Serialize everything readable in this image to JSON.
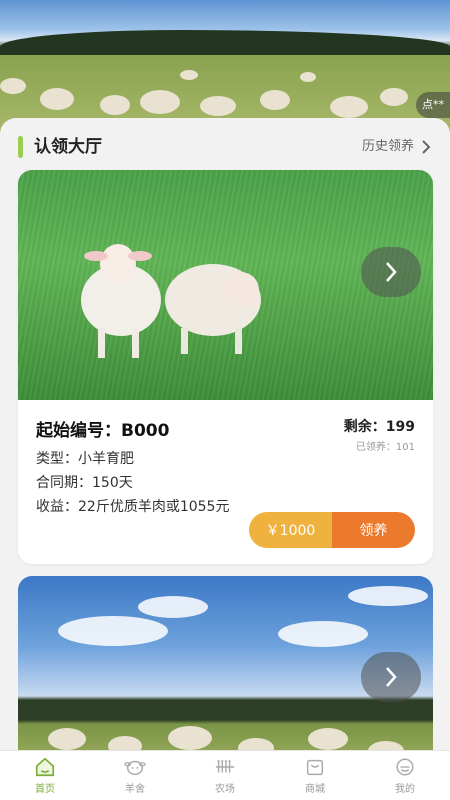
{
  "banner": {
    "badge_text": "点**"
  },
  "section": {
    "title": "认领大厅",
    "history_label": "历史领养"
  },
  "card": {
    "code": "起始编号：B000",
    "remain": "剩余：199",
    "adopted": "已领养：101",
    "type": "类型：小羊育肥",
    "period": "合同期：150天",
    "income": "收益：22斤优质羊肉或1055元",
    "price_label": "￥1000",
    "adopt_label": "领养"
  },
  "tabs": [
    {
      "label": "首页",
      "icon": "home-icon",
      "active": true
    },
    {
      "label": "羊舍",
      "icon": "sheep-icon",
      "active": false
    },
    {
      "label": "农场",
      "icon": "farm-icon",
      "active": false
    },
    {
      "label": "商城",
      "icon": "shop-icon",
      "active": false
    },
    {
      "label": "我的",
      "icon": "profile-icon",
      "active": false
    }
  ],
  "colors": {
    "accent": "#7bab3a",
    "section_bar": "#9ccd52",
    "price_button": "#f0b23e",
    "adopt_button": "#ec7a2c"
  }
}
